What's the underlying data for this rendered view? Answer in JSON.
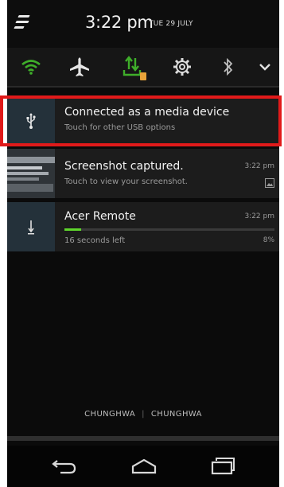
{
  "status": {
    "time": "3:22 pm",
    "date": "TUE 29 JULY"
  },
  "quick_settings": [
    "wifi-icon",
    "airplane-mode-icon",
    "usb-transfer-icon",
    "settings-gear-icon",
    "bluetooth-icon",
    "expand-chevron-icon"
  ],
  "notifications": [
    {
      "title": "Connected as a media device",
      "subtitle": "Touch for other USB options",
      "time": "",
      "icon": "usb-icon"
    },
    {
      "title": "Screenshot captured.",
      "subtitle": "Touch to view your screenshot.",
      "time": "3:22 pm",
      "icon": "screenshot-thumbnail"
    },
    {
      "title": "Acer Remote",
      "subtitle": "16 seconds left",
      "time": "3:22 pm",
      "progress_percent": "8%",
      "progress": 0.08,
      "icon": "download-icon"
    }
  ],
  "carrier": {
    "left": "CHUNGHWA",
    "right": "CHUNGHWA"
  },
  "navigation": [
    "back-icon",
    "home-icon",
    "recents-icon"
  ],
  "colors": {
    "highlight": "#e11a1a",
    "progress": "#5fd52c",
    "icon_bg": "#24313a",
    "usb_orange": "#e8a33a"
  }
}
